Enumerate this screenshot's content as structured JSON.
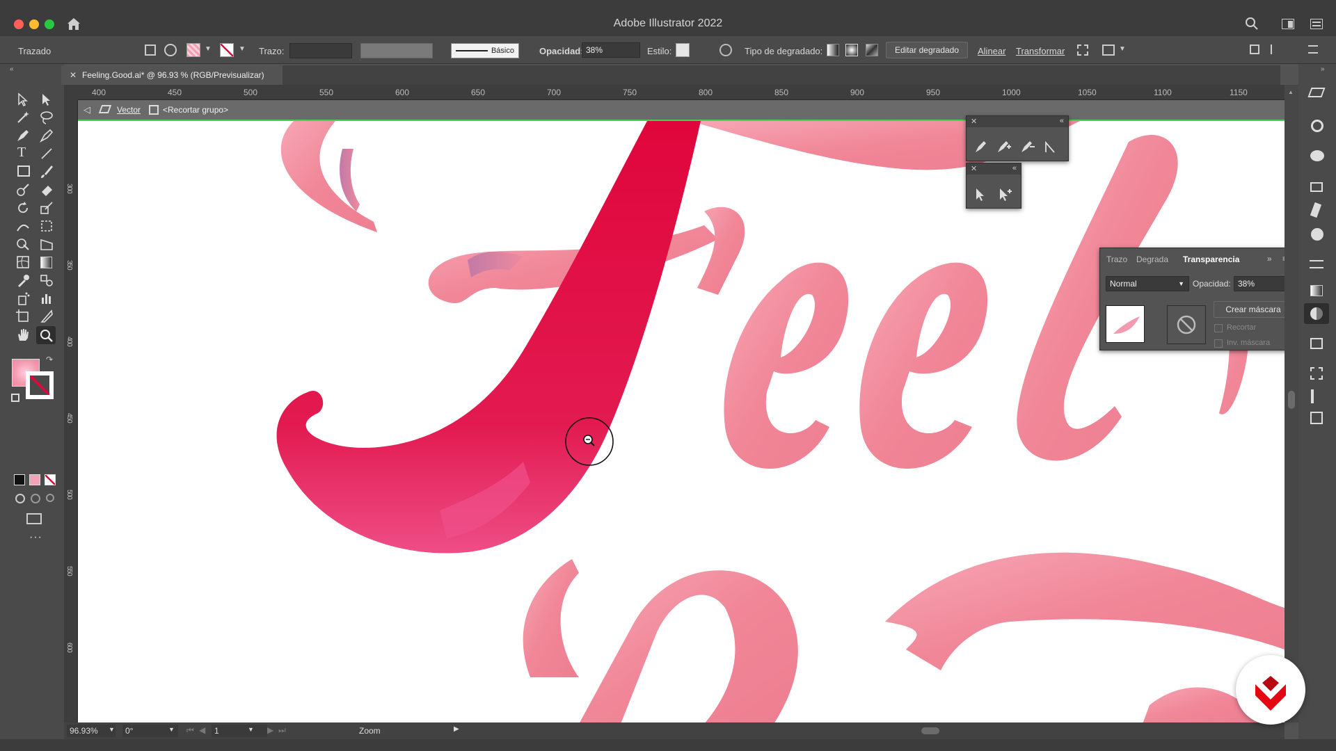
{
  "window": {
    "title": "Adobe Illustrator 2022"
  },
  "control_bar": {
    "selection_label": "Trazado",
    "stroke_label": "Trazo:",
    "brush_preset": "Básico",
    "opacity_label": "Opacidad:",
    "opacity_value": "38%",
    "style_label": "Estilo:",
    "gradient_type_label": "Tipo de degradado:",
    "edit_gradient_button": "Editar degradado",
    "align_link": "Alinear",
    "transform_link": "Transformar"
  },
  "document_tab": {
    "label": "Feeling.Good.ai* @ 96.93 % (RGB/Previsualizar)"
  },
  "ruler": {
    "h_ticks": [
      "400",
      "450",
      "500",
      "550",
      "600",
      "650",
      "700",
      "750",
      "800",
      "850",
      "900",
      "950",
      "1000",
      "1050",
      "1100",
      "1150"
    ],
    "v_ticks": [
      "300",
      "350",
      "400",
      "450",
      "500",
      "550",
      "600"
    ]
  },
  "breadcrumb": {
    "layer": "Vector",
    "group": "<Recortar grupo>"
  },
  "transparency_panel": {
    "tabs": [
      "Trazo",
      "Degrada",
      "Transparencia"
    ],
    "active_tab": "Transparencia",
    "blend_mode": "Normal",
    "opacity_label": "Opacidad:",
    "opacity_value": "38%",
    "make_mask_button": "Crear máscara",
    "clip_checkbox": "Recortar",
    "invert_mask_checkbox": "Inv. máscara"
  },
  "status_bar": {
    "zoom": "96.93%",
    "rotation": "0°",
    "artboard": "1",
    "tool_name": "Zoom"
  },
  "canvas": {
    "artwork_text": "Feeling",
    "accent_color": "#e0063c",
    "lettering_color": "#f2879a"
  },
  "icons": [
    "apple-home-icon",
    "search-icon",
    "arrange-icon",
    "pen-tool-icon",
    "anchor-add-icon",
    "zoom-cursor-icon",
    "brand-logo-icon"
  ]
}
